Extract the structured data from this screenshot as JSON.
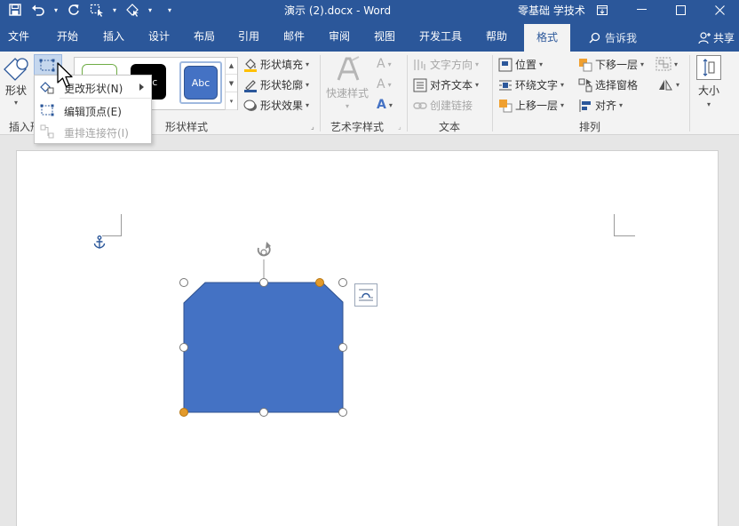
{
  "window": {
    "doc_title": "演示 (2).docx  -  Word",
    "brand": "零基础 学技术",
    "qat": {
      "undo_caret": "▾",
      "more": "▾"
    }
  },
  "tabs": [
    "文件",
    "开始",
    "插入",
    "设计",
    "布局",
    "引用",
    "邮件",
    "审阅",
    "视图",
    "开发工具",
    "帮助",
    "格式"
  ],
  "active_tab": "格式",
  "tell_me": "告诉我",
  "share": "共享",
  "ribbon": {
    "insert_shapes": {
      "shape_label": "形状",
      "group_label": "插入形"
    },
    "shape_styles": {
      "swatch_text": "Abc",
      "fill": "形状填充",
      "outline": "形状轮廓",
      "effects": "形状效果",
      "group_label": "形状样式"
    },
    "wordart": {
      "quick_styles": "快速样式",
      "group_label": "艺术字样式"
    },
    "text": {
      "direction": "文字方向",
      "align": "对齐文本",
      "link": "创建链接",
      "group_label": "文本"
    },
    "arrange": {
      "position": "位置",
      "wrap": "环绕文字",
      "bring_forward": "上移一层",
      "send_backward": "下移一层",
      "selection_pane": "选择窗格",
      "align": "对齐",
      "group_label": "排列"
    },
    "size": {
      "label": "大小"
    }
  },
  "edit_shape_menu": {
    "items": [
      {
        "label": "更改形状(N)",
        "enabled": true
      },
      {
        "label": "编辑顶点(E)",
        "enabled": true
      },
      {
        "label": "重排连接符(I)",
        "enabled": false
      }
    ]
  },
  "colors": {
    "accent": "#2b579a",
    "shape_fill": "#4472c4",
    "shape_stroke": "#2f528f",
    "handle_adjust": "#e39a2b"
  }
}
